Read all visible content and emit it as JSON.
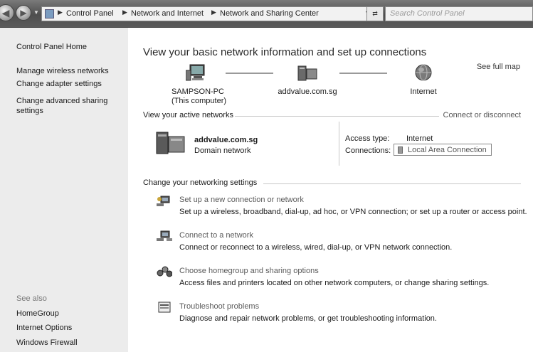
{
  "address_bar": {
    "crumbs": [
      "Control Panel",
      "Network and Internet",
      "Network and Sharing Center"
    ],
    "search_placeholder": "Search Control Panel"
  },
  "sidebar": {
    "home": "Control Panel Home",
    "items": [
      {
        "label": "Manage wireless networks"
      },
      {
        "label": "Change adapter settings"
      },
      {
        "label": "Change advanced sharing settings"
      }
    ],
    "see_also": "See also",
    "see_also_items": [
      {
        "label": "HomeGroup"
      },
      {
        "label": "Internet Options"
      },
      {
        "label": "Windows Firewall"
      }
    ]
  },
  "main": {
    "title": "View your basic network information and set up connections",
    "see_full_map": "See full map",
    "map": {
      "computer_name": "SAMPSON-PC",
      "computer_sub": "(This computer)",
      "network": "addvalue.com.sg",
      "internet": "Internet"
    },
    "active_networks": {
      "heading": "View your active networks",
      "action": "Connect or disconnect",
      "network_name": "addvalue.com.sg",
      "network_type": "Domain network",
      "access_type_label": "Access type:",
      "access_type_value": "Internet",
      "connections_label": "Connections:",
      "connections_value": "Local Area Connection"
    },
    "settings": {
      "heading": "Change your networking settings",
      "tasks": [
        {
          "title": "Set up a new connection or network",
          "desc": "Set up a wireless, broadband, dial-up, ad hoc, or VPN connection; or set up a router or access point."
        },
        {
          "title": "Connect to a network",
          "desc": "Connect or reconnect to a wireless, wired, dial-up, or VPN network connection."
        },
        {
          "title": "Choose homegroup and sharing options",
          "desc": "Access files and printers located on other network computers, or change sharing settings."
        },
        {
          "title": "Troubleshoot problems",
          "desc": "Diagnose and repair network problems, or get troubleshooting information."
        }
      ]
    }
  }
}
